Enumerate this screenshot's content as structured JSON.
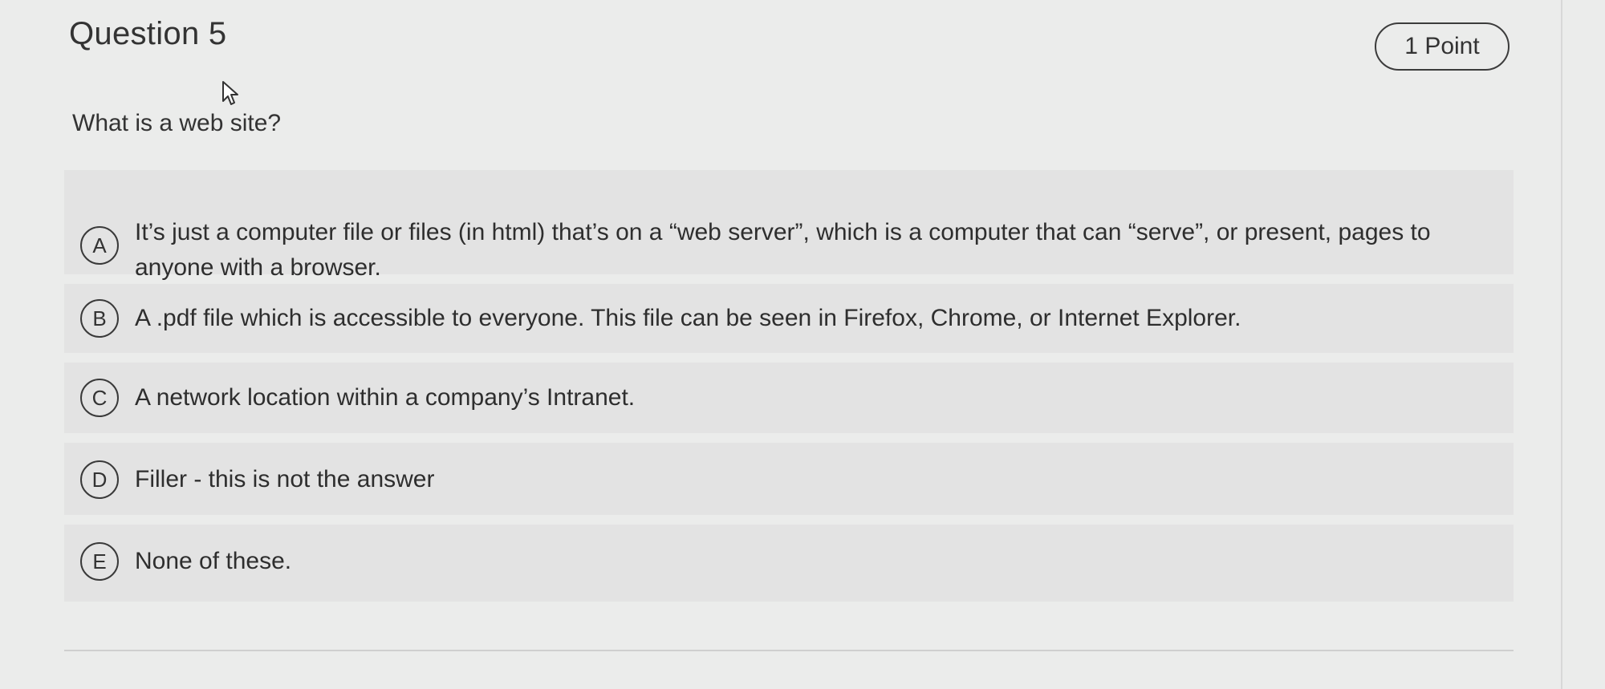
{
  "question": {
    "title": "Question 5",
    "points": "1 Point",
    "prompt": "What is a web site?"
  },
  "options": [
    {
      "letter": "A",
      "text": "It’s just a computer file or files (in html) that’s on a “web server”, which is a computer that can “serve”, or present, pages to anyone with a browser."
    },
    {
      "letter": "B",
      "text": "A .pdf file which is accessible to everyone. This file can be seen in Firefox, Chrome, or Internet Explorer."
    },
    {
      "letter": "C",
      "text": "A network location within a company’s Intranet."
    },
    {
      "letter": "D",
      "text": "Filler - this is not the answer"
    },
    {
      "letter": "E",
      "text": "None of these."
    }
  ],
  "icons": {
    "cursor": "mouse-pointer-icon"
  },
  "colors": {
    "background": "#ebeceb",
    "option_background": "#e3e3e3",
    "text": "#2e2e2e"
  }
}
